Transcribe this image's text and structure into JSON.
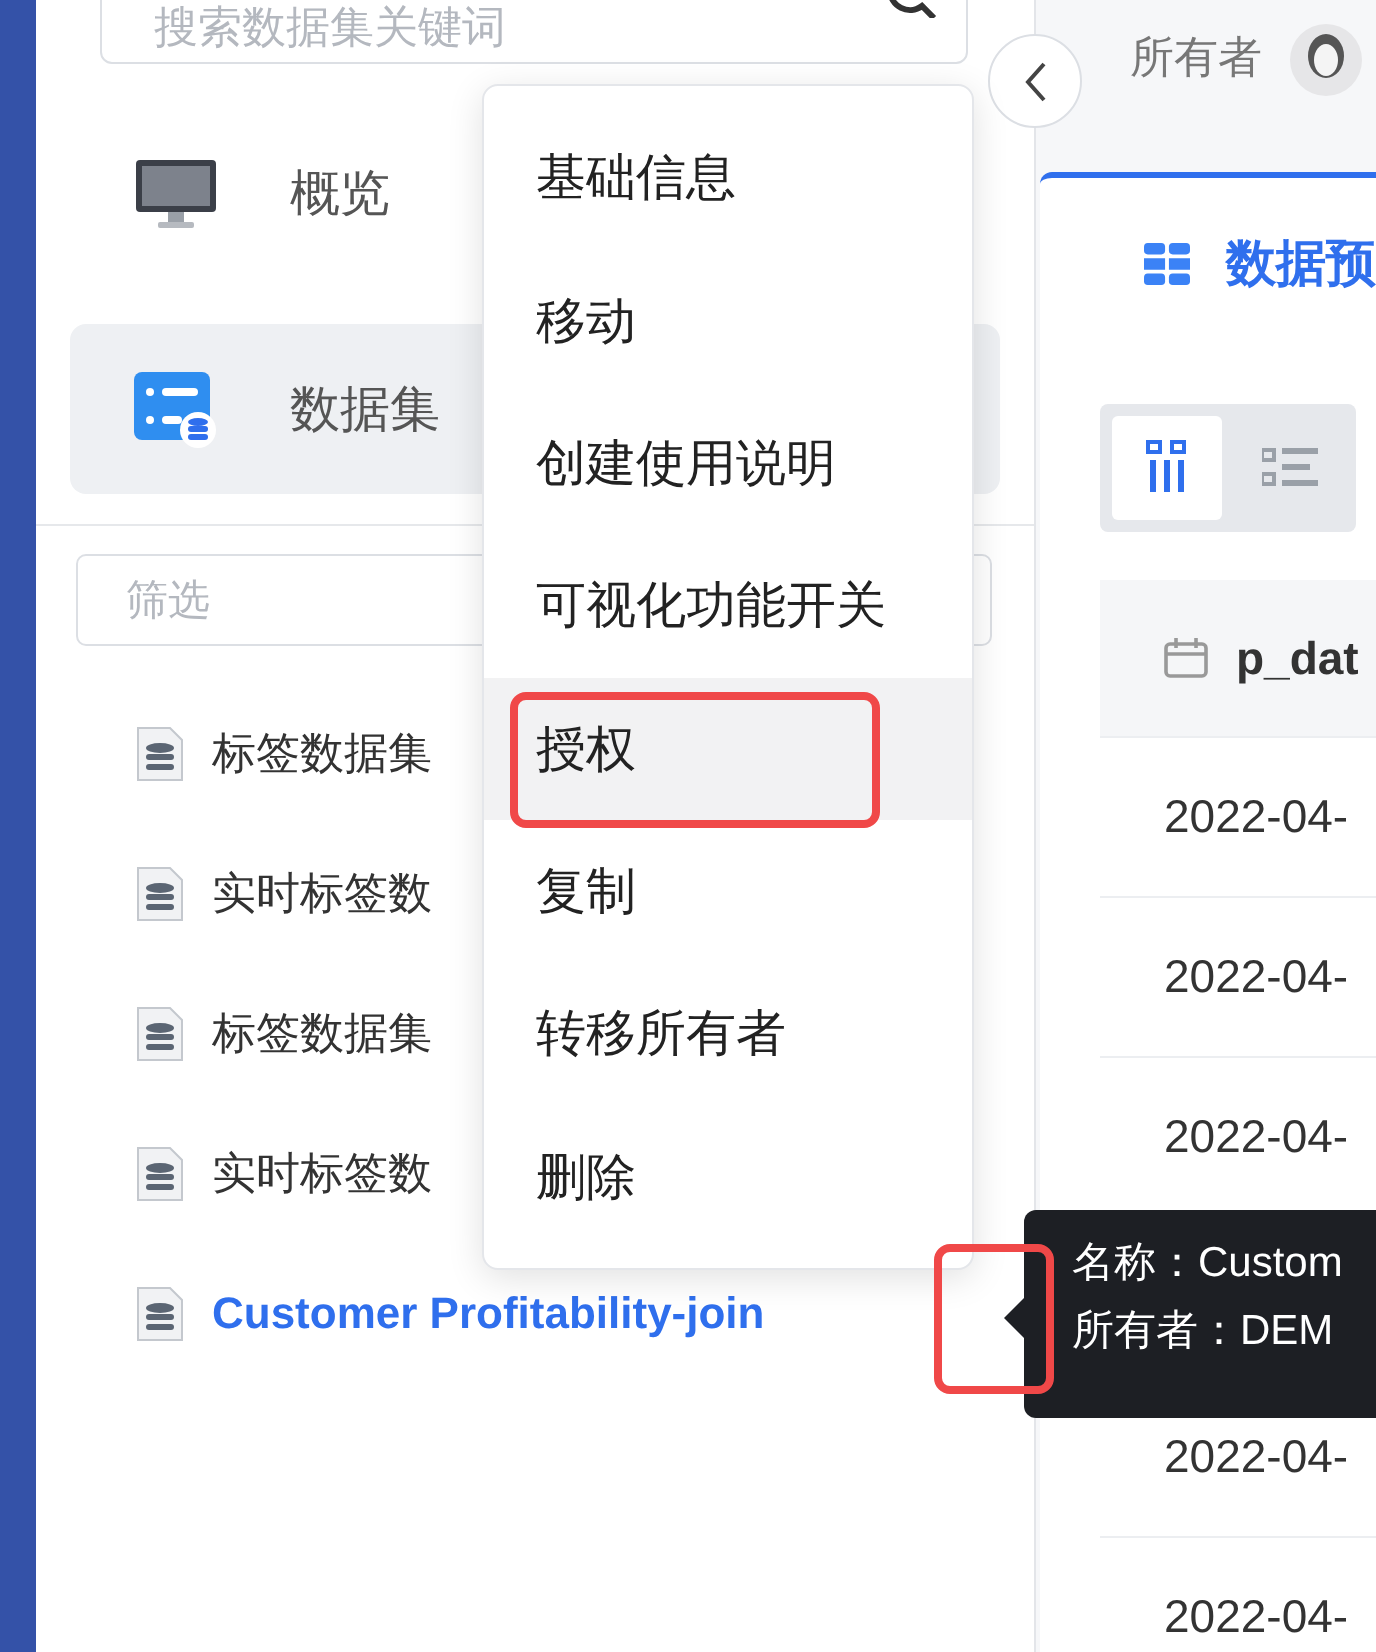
{
  "sidebar": {
    "search": {
      "placeholder": "搜索数据集关键词"
    },
    "nav": [
      {
        "label": "概览",
        "selected": false
      },
      {
        "label": "数据集",
        "selected": true
      }
    ],
    "filter": {
      "placeholder": "筛选"
    },
    "datasets": [
      {
        "name": "标签数据集",
        "selected": false
      },
      {
        "name": "实时标签数",
        "selected": false
      },
      {
        "name": "标签数据集",
        "selected": false
      },
      {
        "name": "实时标签数",
        "selected": false
      },
      {
        "name": "Customer Profitability-join",
        "selected": true
      }
    ]
  },
  "context_menu": [
    {
      "label": "基础信息",
      "highlighted": false
    },
    {
      "label": "移动",
      "highlighted": false
    },
    {
      "label": "创建使用说明",
      "highlighted": false
    },
    {
      "label": "可视化功能开关",
      "highlighted": false
    },
    {
      "label": "授权",
      "highlighted": true
    },
    {
      "label": "复制",
      "highlighted": false
    },
    {
      "label": "转移所有者",
      "highlighted": false
    },
    {
      "label": "删除",
      "highlighted": false
    }
  ],
  "main": {
    "owner_label": "所有者",
    "tab": {
      "label": "数据预",
      "selected": true
    },
    "view_toggle": [
      {
        "kind": "columns",
        "selected": true
      },
      {
        "kind": "list",
        "selected": false
      }
    ],
    "table": {
      "column": "p_dat",
      "rows_above_tooltip": [
        "2022-04-",
        "2022-04-",
        "2022-04-"
      ],
      "rows_below_tooltip": [
        "2022-04-",
        "2022-04-"
      ]
    }
  },
  "tooltip": {
    "lines": [
      "名称：Custom",
      "所有者：DEM"
    ]
  }
}
